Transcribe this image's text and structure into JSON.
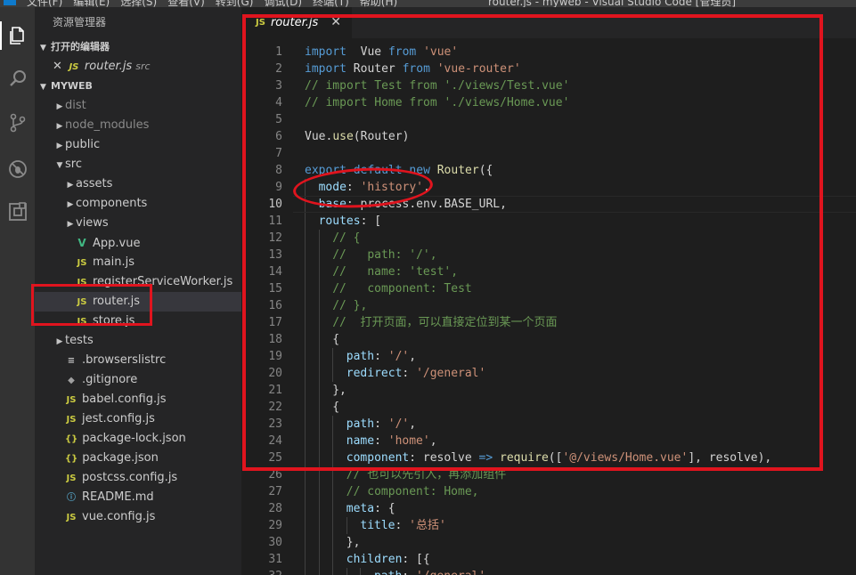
{
  "titlebar": {
    "menu": [
      "文件(F)",
      "编辑(E)",
      "选择(S)",
      "查看(V)",
      "转到(G)",
      "调试(D)",
      "终端(T)",
      "帮助(H)"
    ],
    "window_title": "router.js - myweb - Visual Studio Code [管理员]"
  },
  "activity_bar": {
    "items": [
      "explorer-icon",
      "search-icon",
      "source-control-icon",
      "debug-icon",
      "extensions-icon"
    ]
  },
  "sidebar": {
    "title": "资源管理器",
    "open_editors": {
      "header": "打开的编辑器",
      "items": [
        {
          "close": "✕",
          "icon": "JS",
          "name": "router.js",
          "dir": "src"
        }
      ]
    },
    "project": {
      "header": "MYWEB",
      "items": [
        {
          "name": "dist",
          "type": "folder",
          "icon": "",
          "dim": true
        },
        {
          "name": "node_modules",
          "type": "folder",
          "icon": "",
          "dim": true
        },
        {
          "name": "public",
          "type": "folder",
          "icon": ""
        },
        {
          "name": "src",
          "type": "folder-open",
          "icon": ""
        },
        {
          "name": "assets",
          "type": "folder",
          "icon": ""
        },
        {
          "name": "components",
          "type": "folder",
          "icon": ""
        },
        {
          "name": "views",
          "type": "folder",
          "icon": ""
        },
        {
          "name": "App.vue",
          "type": "file",
          "icon": "V"
        },
        {
          "name": "main.js",
          "type": "file",
          "icon": "JS"
        },
        {
          "name": "registerServiceWorker.js",
          "type": "file",
          "icon": "JS"
        },
        {
          "name": "router.js",
          "type": "file",
          "icon": "JS"
        },
        {
          "name": "store.js",
          "type": "file",
          "icon": "JS"
        },
        {
          "name": "tests",
          "type": "folder",
          "icon": ""
        },
        {
          "name": ".browserslistrc",
          "type": "file",
          "icon": "≡"
        },
        {
          "name": ".gitignore",
          "type": "file",
          "icon": "◆"
        },
        {
          "name": "babel.config.js",
          "type": "file",
          "icon": "JS"
        },
        {
          "name": "jest.config.js",
          "type": "file",
          "icon": "JS"
        },
        {
          "name": "package-lock.json",
          "type": "file",
          "icon": "{}"
        },
        {
          "name": "package.json",
          "type": "file",
          "icon": "{}"
        },
        {
          "name": "postcss.config.js",
          "type": "file",
          "icon": "JS"
        },
        {
          "name": "README.md",
          "type": "file",
          "icon": "ⓘ"
        },
        {
          "name": "vue.config.js",
          "type": "file",
          "icon": "JS"
        }
      ]
    }
  },
  "editor": {
    "tab": {
      "icon": "JS",
      "label": "router.js",
      "close": "✕"
    },
    "current_line": 10,
    "lines": [
      {
        "n": "1",
        "t": [
          [
            "k",
            "import"
          ],
          [
            "",
            "  Vue "
          ],
          [
            "k",
            "from"
          ],
          [
            "",
            " "
          ],
          [
            "s",
            "'vue'"
          ]
        ]
      },
      {
        "n": "2",
        "t": [
          [
            "k",
            "import"
          ],
          [
            "",
            " Router "
          ],
          [
            "k",
            "from"
          ],
          [
            "",
            " "
          ],
          [
            "s",
            "'vue-router'"
          ]
        ]
      },
      {
        "n": "3",
        "t": [
          [
            "c",
            "// import Test from './views/Test.vue'"
          ]
        ]
      },
      {
        "n": "4",
        "t": [
          [
            "c",
            "// import Home from './views/Home.vue'"
          ]
        ]
      },
      {
        "n": "5",
        "t": []
      },
      {
        "n": "6",
        "t": [
          [
            "",
            "Vue."
          ],
          [
            "f",
            "use"
          ],
          [
            "",
            "(Router)"
          ]
        ]
      },
      {
        "n": "7",
        "t": []
      },
      {
        "n": "8",
        "t": [
          [
            "k",
            "export"
          ],
          [
            "",
            " "
          ],
          [
            "k",
            "default"
          ],
          [
            "",
            " "
          ],
          [
            "k",
            "new"
          ],
          [
            "",
            " "
          ],
          [
            "f",
            "Router"
          ],
          [
            "",
            "({"
          ]
        ]
      },
      {
        "n": "9",
        "i": 1,
        "t": [
          [
            "p",
            "mode"
          ],
          [
            "",
            ": "
          ],
          [
            "s",
            "'history'"
          ],
          [
            "",
            ","
          ]
        ]
      },
      {
        "n": "10",
        "i": 1,
        "t": [
          [
            "p",
            "base"
          ],
          [
            "",
            ": process.env.BASE_URL,"
          ]
        ]
      },
      {
        "n": "11",
        "i": 1,
        "t": [
          [
            "p",
            "routes"
          ],
          [
            "",
            ": ["
          ]
        ]
      },
      {
        "n": "12",
        "i": 2,
        "t": [
          [
            "c",
            "// {"
          ]
        ]
      },
      {
        "n": "13",
        "i": 2,
        "t": [
          [
            "c",
            "//   path: '/',"
          ]
        ]
      },
      {
        "n": "14",
        "i": 2,
        "t": [
          [
            "c",
            "//   name: 'test',"
          ]
        ]
      },
      {
        "n": "15",
        "i": 2,
        "t": [
          [
            "c",
            "//   component: Test"
          ]
        ]
      },
      {
        "n": "16",
        "i": 2,
        "t": [
          [
            "c",
            "// },"
          ]
        ]
      },
      {
        "n": "17",
        "i": 2,
        "t": [
          [
            "c",
            "//  打开页面，可以直接定位到某一个页面"
          ]
        ]
      },
      {
        "n": "18",
        "i": 2,
        "t": [
          [
            "",
            "{"
          ]
        ]
      },
      {
        "n": "19",
        "i": 3,
        "t": [
          [
            "p",
            "path"
          ],
          [
            "",
            ": "
          ],
          [
            "s",
            "'/'"
          ],
          [
            "",
            ","
          ]
        ]
      },
      {
        "n": "20",
        "i": 3,
        "t": [
          [
            "p",
            "redirect"
          ],
          [
            "",
            ": "
          ],
          [
            "s",
            "'/general'"
          ]
        ]
      },
      {
        "n": "21",
        "i": 2,
        "t": [
          [
            "",
            "},"
          ]
        ]
      },
      {
        "n": "22",
        "i": 2,
        "t": [
          [
            "",
            "{"
          ]
        ]
      },
      {
        "n": "23",
        "i": 3,
        "t": [
          [
            "p",
            "path"
          ],
          [
            "",
            ": "
          ],
          [
            "s",
            "'/'"
          ],
          [
            "",
            ","
          ]
        ]
      },
      {
        "n": "24",
        "i": 3,
        "t": [
          [
            "p",
            "name"
          ],
          [
            "",
            ": "
          ],
          [
            "s",
            "'home'"
          ],
          [
            "",
            ","
          ]
        ]
      },
      {
        "n": "25",
        "i": 3,
        "t": [
          [
            "p",
            "component"
          ],
          [
            "",
            ": resolve "
          ],
          [
            "k",
            "=>"
          ],
          [
            "",
            " "
          ],
          [
            "f",
            "require"
          ],
          [
            "",
            "(["
          ],
          [
            "s",
            "'@/views/Home.vue'"
          ],
          [
            "",
            "], resolve),"
          ]
        ]
      },
      {
        "n": "26",
        "i": 3,
        "t": [
          [
            "c",
            "// 也可以先引入，再添加组件"
          ]
        ]
      },
      {
        "n": "27",
        "i": 3,
        "t": [
          [
            "c",
            "// component: Home,"
          ]
        ]
      },
      {
        "n": "28",
        "i": 3,
        "t": [
          [
            "p",
            "meta"
          ],
          [
            "",
            ": {"
          ]
        ]
      },
      {
        "n": "29",
        "i": 4,
        "t": [
          [
            "p",
            "title"
          ],
          [
            "",
            ": "
          ],
          [
            "s",
            "'总括'"
          ]
        ]
      },
      {
        "n": "30",
        "i": 3,
        "t": [
          [
            "",
            "},"
          ]
        ]
      },
      {
        "n": "31",
        "i": 3,
        "t": [
          [
            "p",
            "children"
          ],
          [
            "",
            ": [{"
          ]
        ]
      },
      {
        "n": "32",
        "i": 5,
        "t": [
          [
            "p",
            "path"
          ],
          [
            "",
            ": "
          ],
          [
            "s",
            "'/general'"
          ]
        ]
      }
    ]
  },
  "colors": {
    "annotation": "#e0141e",
    "keyword": "#569cd6",
    "string": "#ce9178",
    "comment": "#6a9955"
  }
}
